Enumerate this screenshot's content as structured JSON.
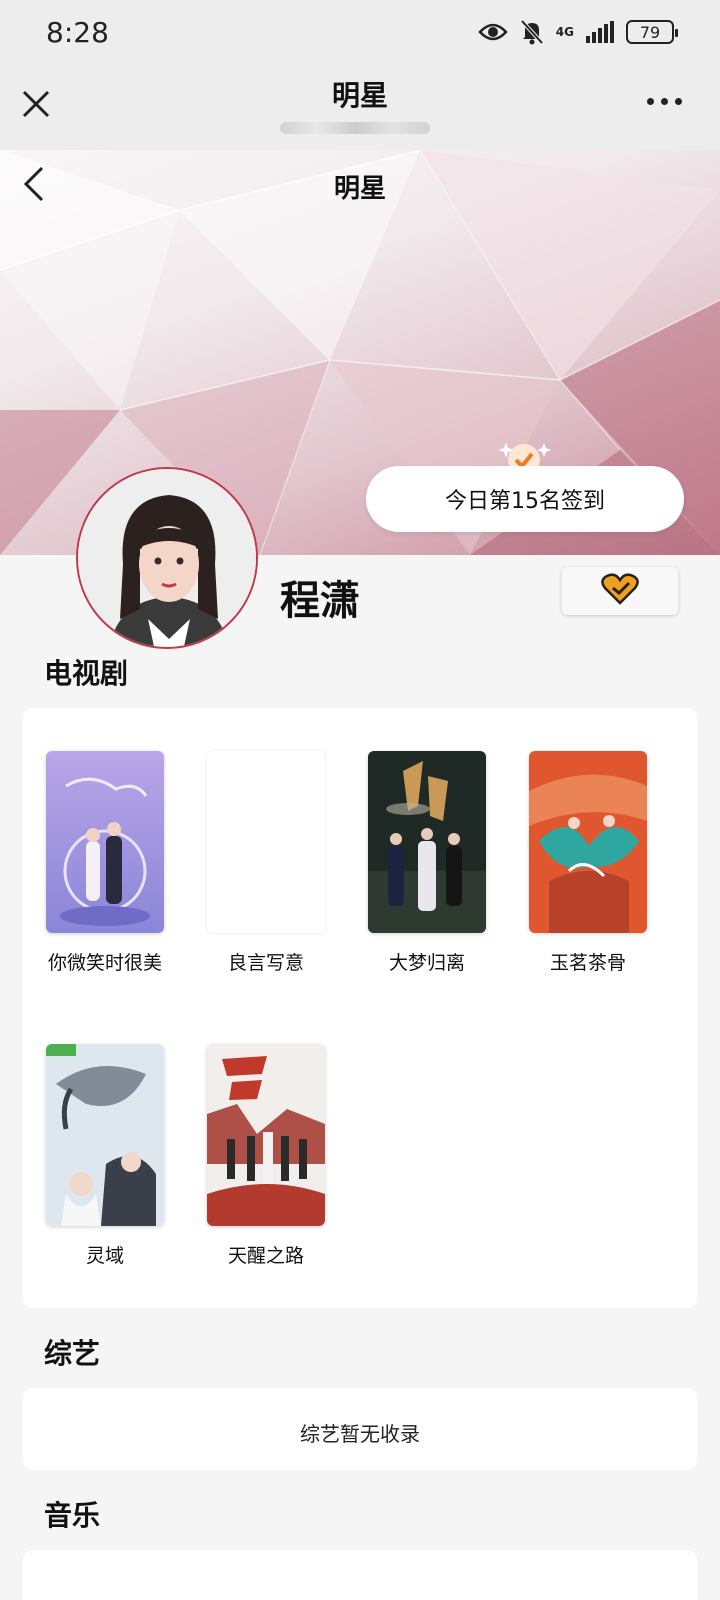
{
  "status_bar": {
    "time": "8:28",
    "network": "4G",
    "battery": "79"
  },
  "top_bar": {
    "title": "明星"
  },
  "banner": {
    "title": "明星",
    "checkin_label": "今日第15名签到"
  },
  "profile": {
    "name": "程潇"
  },
  "dramas": {
    "title": "电视剧",
    "items": [
      {
        "name": "你微笑时很美"
      },
      {
        "name": "良言写意"
      },
      {
        "name": "大梦归离"
      },
      {
        "name": "玉茗茶骨"
      },
      {
        "name": "灵域"
      },
      {
        "name": "天醒之路"
      }
    ]
  },
  "variety": {
    "title": "综艺",
    "empty_text": "综艺暂无收录"
  },
  "music": {
    "title": "音乐"
  },
  "colors": {
    "accent": "#f0a020",
    "avatar_ring": "#c0394b",
    "page_bg": "#f5f5f5",
    "banner_tint": "#c98a98"
  },
  "icons": {
    "close": "close-icon",
    "more": "more-icon",
    "back": "back-icon",
    "checkin": "checkmark-badge-icon",
    "follow": "heart-check-icon",
    "eye": "eye-icon",
    "mute": "bell-off-icon",
    "signal": "signal-icon"
  }
}
